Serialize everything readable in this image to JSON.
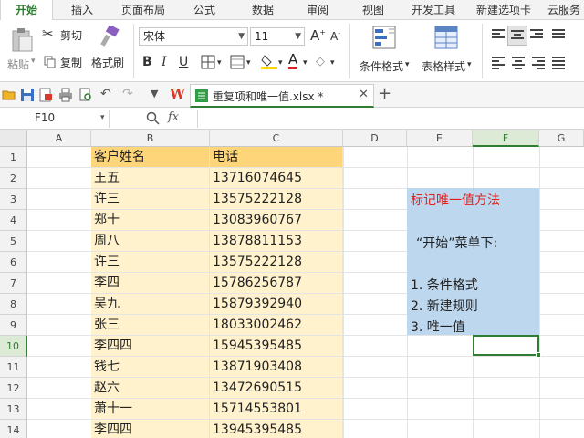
{
  "tabs": [
    "开始",
    "插入",
    "页面布局",
    "公式",
    "数据",
    "审阅",
    "视图",
    "开发工具",
    "新建选项卡",
    "云服务"
  ],
  "ribbon": {
    "paste_label": "粘贴",
    "cut_label": "剪切",
    "copy_label": "复制",
    "format_painter_label": "格式刷",
    "font_name": "宋体",
    "font_size": "11",
    "bold": "B",
    "italic": "I",
    "underline": "U",
    "cond_format_label": "条件格式",
    "table_style_label": "表格样式"
  },
  "document_tab": {
    "name": "重复项和唯一值.xlsx *"
  },
  "formula_bar": {
    "name_box": "F10",
    "fx": "fx",
    "value": ""
  },
  "columns": [
    "A",
    "B",
    "C",
    "D",
    "E",
    "F",
    "G"
  ],
  "rows": [
    "1",
    "2",
    "3",
    "4",
    "5",
    "6",
    "7",
    "8",
    "9",
    "10",
    "11",
    "12",
    "13",
    "14"
  ],
  "sheet": {
    "header": [
      "客户姓名",
      "电话"
    ],
    "records": [
      [
        "王五",
        "13716074645"
      ],
      [
        "许三",
        "13575222128"
      ],
      [
        "郑十",
        "13083960767"
      ],
      [
        "周八",
        "13878811153"
      ],
      [
        "许三",
        "13575222128"
      ],
      [
        "李四",
        "15786256787"
      ],
      [
        "吴九",
        "15879392940"
      ],
      [
        "张三",
        "18033002462"
      ],
      [
        "李四四",
        "15945395485"
      ],
      [
        "钱七",
        "13871903408"
      ],
      [
        "赵六",
        "13472690515"
      ],
      [
        "萧十一",
        "15714553801"
      ],
      [
        "李四四",
        "13945395485"
      ]
    ]
  },
  "note": {
    "title": "标记唯一值方法",
    "line1": "“开始”菜单下:",
    "step1": "1. 条件格式",
    "step2": "2. 新建规则",
    "step3": "3. 唯一值",
    "title_color": "#e02020"
  },
  "colors": {
    "accent": "#2f7d32",
    "header_fill": "#ffd57a",
    "body_fill": "#fff2cc",
    "note_fill": "#bdd7ee"
  }
}
